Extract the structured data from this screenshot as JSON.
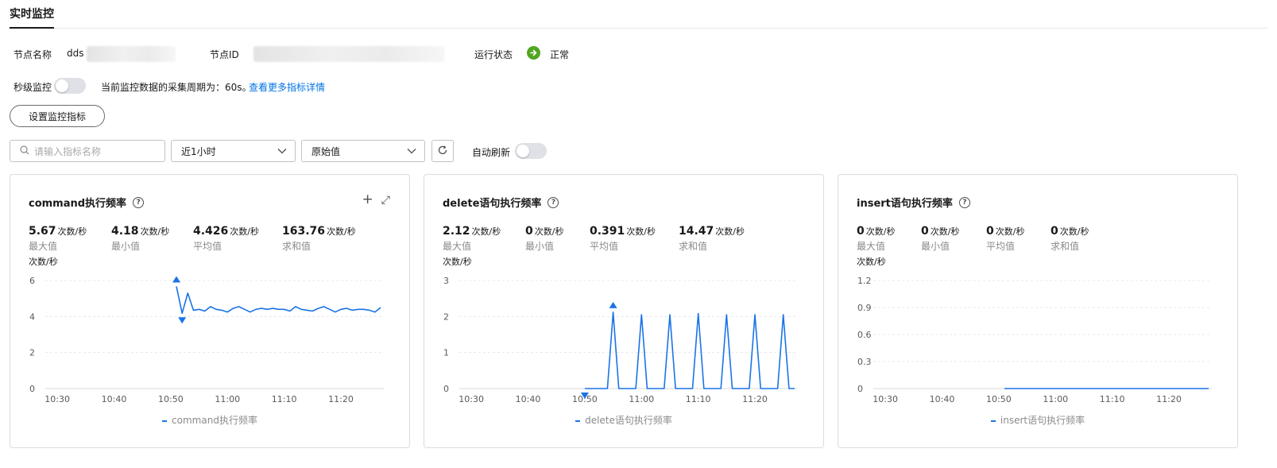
{
  "tab": {
    "label": "实时监控"
  },
  "info": {
    "node_name_label": "节点名称",
    "node_name_value": "dds",
    "node_id_label": "节点ID",
    "status_label": "运行状态",
    "status_value": "正常"
  },
  "second_monitor": {
    "label": "秒级监控",
    "period_text": "当前监控数据的采集周期为：60s。",
    "more_link": "查看更多指标详情"
  },
  "set_metrics_button": "设置监控指标",
  "filters": {
    "search_placeholder": "请输入指标名称",
    "time_range": "近1小时",
    "value_type": "原始值",
    "auto_refresh_label": "自动刷新"
  },
  "colors": {
    "series": "#1a73e8",
    "status_ok": "#52a61f",
    "link": "#0073e6"
  },
  "cards": [
    {
      "title": "command执行频率",
      "stats": [
        {
          "value": "5.67",
          "unit": "次数/秒",
          "label": "最大值"
        },
        {
          "value": "4.18",
          "unit": "次数/秒",
          "label": "最小值"
        },
        {
          "value": "4.426",
          "unit": "次数/秒",
          "label": "平均值"
        },
        {
          "value": "163.76",
          "unit": "次数/秒",
          "label": "求和值"
        }
      ],
      "yunit": "次数/秒",
      "legend": "command执行频率",
      "tool_add": "+",
      "tool_expand": "⤢"
    },
    {
      "title": "delete语句执行频率",
      "stats": [
        {
          "value": "2.12",
          "unit": "次数/秒",
          "label": "最大值"
        },
        {
          "value": "0",
          "unit": "次数/秒",
          "label": "最小值"
        },
        {
          "value": "0.391",
          "unit": "次数/秒",
          "label": "平均值"
        },
        {
          "value": "14.47",
          "unit": "次数/秒",
          "label": "求和值"
        }
      ],
      "yunit": "次数/秒",
      "legend": "delete语句执行频率"
    },
    {
      "title": "insert语句执行频率",
      "stats": [
        {
          "value": "0",
          "unit": "次数/秒",
          "label": "最大值"
        },
        {
          "value": "0",
          "unit": "次数/秒",
          "label": "最小值"
        },
        {
          "value": "0",
          "unit": "次数/秒",
          "label": "平均值"
        },
        {
          "value": "0",
          "unit": "次数/秒",
          "label": "求和值"
        }
      ],
      "yunit": "次数/秒",
      "legend": "insert语句执行频率"
    }
  ],
  "chart_data": [
    {
      "type": "line",
      "x_ticks": [
        "10:30",
        "10:40",
        "10:50",
        "11:00",
        "11:10",
        "11:20"
      ],
      "y_ticks": [
        0,
        2,
        4,
        6
      ],
      "ylim": [
        0,
        6
      ],
      "x_start": "10:29",
      "x_end": "11:27",
      "grid": true,
      "series": [
        {
          "name": "command执行频率",
          "x": [
            "10:51",
            "10:52",
            "10:53",
            "10:54",
            "10:55",
            "10:56",
            "10:57",
            "10:58",
            "10:59",
            "11:00",
            "11:01",
            "11:02",
            "11:03",
            "11:04",
            "11:05",
            "11:06",
            "11:07",
            "11:08",
            "11:09",
            "11:10",
            "11:11",
            "11:12",
            "11:13",
            "11:14",
            "11:15",
            "11:16",
            "11:17",
            "11:18",
            "11:19",
            "11:20",
            "11:21",
            "11:22",
            "11:23",
            "11:24",
            "11:25",
            "11:26",
            "11:27"
          ],
          "y": [
            5.67,
            4.18,
            5.3,
            4.35,
            4.4,
            4.3,
            4.55,
            4.4,
            4.35,
            4.25,
            4.45,
            4.55,
            4.4,
            4.25,
            4.4,
            4.45,
            4.4,
            4.45,
            4.4,
            4.4,
            4.3,
            4.55,
            4.4,
            4.35,
            4.3,
            4.45,
            4.55,
            4.4,
            4.25,
            4.4,
            4.45,
            4.35,
            4.4,
            4.4,
            4.35,
            4.25,
            4.5
          ]
        }
      ],
      "max_marker": {
        "x": "10:51",
        "y": 5.67
      },
      "min_marker": {
        "x": "10:52",
        "y": 4.18
      }
    },
    {
      "type": "line",
      "x_ticks": [
        "10:30",
        "10:40",
        "10:50",
        "11:00",
        "11:10",
        "11:20"
      ],
      "y_ticks": [
        0,
        1,
        2,
        3
      ],
      "ylim": [
        0,
        3
      ],
      "x_start": "10:29",
      "x_end": "11:27",
      "grid": true,
      "series": [
        {
          "name": "delete语句执行频率",
          "x": [
            "10:50",
            "10:51",
            "10:52",
            "10:53",
            "10:54",
            "10:55",
            "10:56",
            "10:57",
            "10:58",
            "10:59",
            "11:00",
            "11:01",
            "11:02",
            "11:03",
            "11:04",
            "11:05",
            "11:06",
            "11:07",
            "11:08",
            "11:09",
            "11:10",
            "11:11",
            "11:12",
            "11:13",
            "11:14",
            "11:15",
            "11:16",
            "11:17",
            "11:18",
            "11:19",
            "11:20",
            "11:21",
            "11:22",
            "11:23",
            "11:24",
            "11:25",
            "11:26",
            "11:27"
          ],
          "y": [
            0,
            0,
            0,
            0,
            0,
            2.12,
            0,
            0,
            0,
            0,
            2.05,
            0,
            0,
            0,
            0,
            2.05,
            0,
            0,
            0,
            0,
            2.08,
            0,
            0,
            0,
            0,
            2.05,
            0,
            0,
            0,
            0,
            2.05,
            0,
            0,
            0,
            0,
            2.05,
            0,
            0
          ]
        }
      ],
      "max_marker": {
        "x": "10:55",
        "y": 2.12
      },
      "min_marker": {
        "x": "10:50",
        "y": 0
      }
    },
    {
      "type": "line",
      "x_ticks": [
        "10:30",
        "10:40",
        "10:50",
        "11:00",
        "11:10",
        "11:20"
      ],
      "y_ticks": [
        0,
        0.3,
        0.6,
        0.9,
        1.2
      ],
      "ylim": [
        0,
        1.2
      ],
      "x_start": "10:29",
      "x_end": "11:27",
      "grid": true,
      "series": [
        {
          "name": "insert语句执行频率",
          "x": [
            "10:51",
            "11:27"
          ],
          "y": [
            0,
            0
          ]
        }
      ]
    }
  ]
}
